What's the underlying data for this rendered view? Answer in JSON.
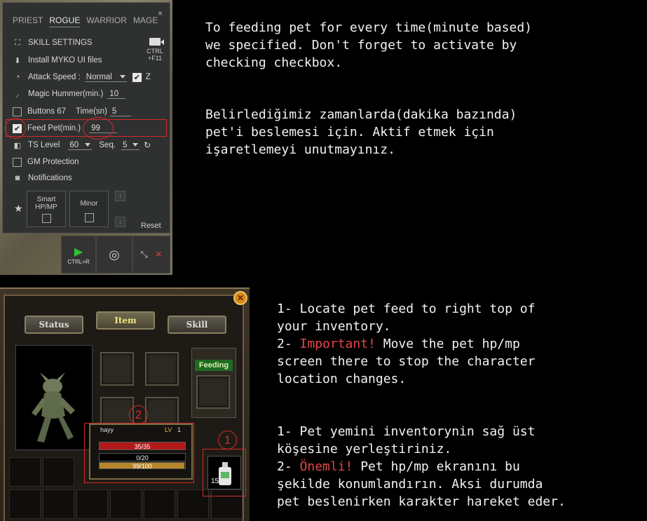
{
  "settings_panel": {
    "class_tabs": [
      "PRIEST",
      "ROGUE",
      "WARRIOR",
      "MAGE"
    ],
    "active_tab": "ROGUE",
    "close_label": "×",
    "record": {
      "line1": "CTRL",
      "line2": "+F11"
    },
    "rows": {
      "skill_settings": "SKILL SETTINGS",
      "install_ui": "Install MYKO UI files",
      "attack_speed_label": "Attack Speed :",
      "attack_speed_value": "Normal",
      "attack_speed_z": "Z",
      "magic_hummer_label": "Magic Hummer(min.)",
      "magic_hummer_value": "10",
      "buttons_label": "Buttons 67",
      "time_label": "Time(sn)",
      "time_value": "5",
      "feed_pet_label": "Feed Pet(min.)",
      "feed_pet_value": "99",
      "ts_level_label": "TS Level",
      "ts_level_value": "60",
      "seq_label": "Seq.",
      "seq_value": "5",
      "gm_protection": "GM Protection",
      "notifications": "Notifications"
    },
    "smart_box": {
      "line1": "Smart",
      "line2": "HP/MP"
    },
    "minor_box": {
      "line1": "Minor"
    },
    "reset_label": "Reset",
    "bottom_bar": {
      "play_hint": "CTRL+R"
    }
  },
  "game_window": {
    "tabs": [
      "Status",
      "Item",
      "Skill"
    ],
    "active_tab": "Item",
    "feeding_label": "Feeding",
    "pet": {
      "name": "hayy",
      "lv_label": "LV",
      "level": "1",
      "hp": "35/35",
      "mp": "0/20",
      "exp": "99/100"
    },
    "potion_count": "15",
    "marker_1": "1",
    "marker_2": "2"
  },
  "text_en_1": "To feeding pet for every time(minute based)\nwe specified. Don't forget to activate by\nchecking checkbox.",
  "text_tr_1": "Belirlediğimiz zamanlarda(dakika bazında)\npet'i beslemesi için. Aktif etmek için\nişaretlemeyi unutmayınız.",
  "text_en_2": {
    "line1": "1- Locate pet feed to right top of\nyour inventory.",
    "line2_prefix": "2- ",
    "line2_highlight": "Important!",
    "line2_rest": " Move the pet hp/mp\nscreen there to stop the character\nlocation changes."
  },
  "text_tr_2": {
    "line1": "1- Pet yemini inventorynin sağ üst\nköşesine yerleştiriniz.",
    "line2_prefix": "2- ",
    "line2_highlight": "Önemli!",
    "line2_rest": " Pet hp/mp ekranını bu\nşekilde konumlandırın. Aksi durumda\npet beslenirken karakter hareket eder."
  },
  "colors": {
    "highlight": "#e64545",
    "annotation_red": "#d42a2a",
    "hp_bar": "#b21a1a",
    "exp_bar": "#b8862a"
  }
}
